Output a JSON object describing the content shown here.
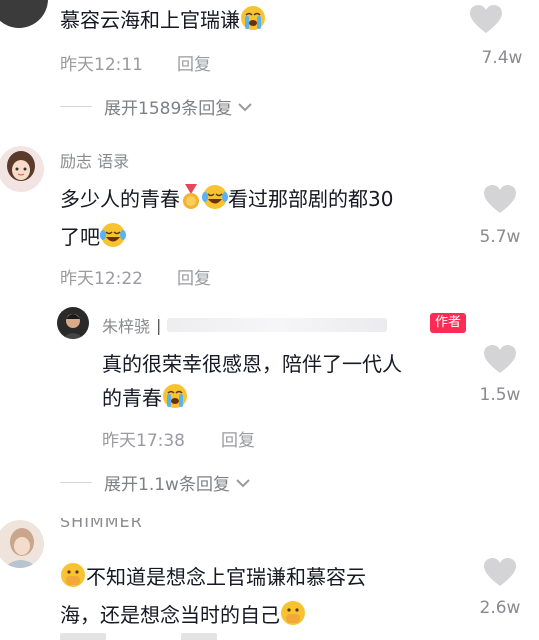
{
  "comments": [
    {
      "text_a": "慕容云海和上官瑞谦",
      "emoji_a": "loudly-crying-face",
      "time": "昨天12:11",
      "reply_label": "回复",
      "likes": "7.4w",
      "expand": "展开1589条回复"
    },
    {
      "username": "励志 语录",
      "line1_a": "多少人的青春",
      "emoji_medal": "sports-medal",
      "emoji_laugh": "face-with-tears-of-joy",
      "line1_b": "看过那部剧的都30",
      "line2_a": "了吧",
      "time": "昨天12:22",
      "reply_label": "回复",
      "likes": "5.7w",
      "reply": {
        "username": "朱梓骁",
        "username_extra": "|",
        "author_badge": "作者",
        "line1": "真的很荣幸很感恩，陪伴了一代人",
        "line2_a": "的青春",
        "time": "昨天17:38",
        "reply_label": "回复",
        "likes": "1.5w"
      },
      "expand": "展开1.1w条回复"
    },
    {
      "username": "SHIMMER",
      "line1_b": "不知道是想念上官瑞谦和慕容云",
      "line2_a": "海，还是想念当时的自己",
      "likes": "2.6w"
    }
  ],
  "colors": {
    "heart": "#d4d4d6",
    "meta": "#9a9ba0",
    "badge": "#fe2c55"
  }
}
